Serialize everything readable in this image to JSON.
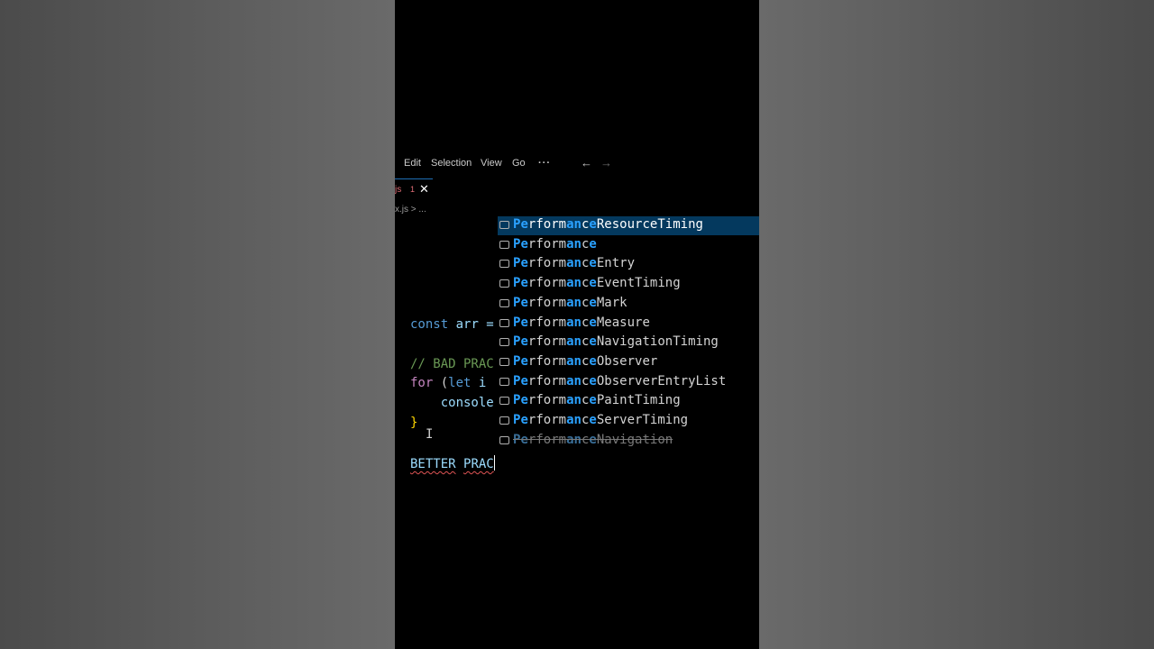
{
  "menubar": {
    "edit": "Edit",
    "selection": "Selection",
    "view": "View",
    "go": "Go",
    "more": "···",
    "back": "←",
    "forward": "→"
  },
  "tab": {
    "name": "js",
    "problems": "1",
    "close": "✕"
  },
  "breadcrumb": "x.js > ...",
  "code": {
    "line1_kw": "const",
    "line1_rest": " arr =",
    "line2_comment": "// BAD PRAC",
    "line3_kw": "for",
    "line3_rest": " (",
    "line3_let": "let",
    "line3_tail": " i",
    "line4": "    console",
    "line5_brace": "}",
    "line6_word1": "BETTER",
    "line6_word2": "PRAC"
  },
  "suggestions": {
    "match_prefix": "Pe",
    "items": [
      {
        "label": "PerformanceResourceTiming",
        "selected": true,
        "deprecated": false
      },
      {
        "label": "Performance",
        "selected": false,
        "deprecated": false
      },
      {
        "label": "PerformanceEntry",
        "selected": false,
        "deprecated": false
      },
      {
        "label": "PerformanceEventTiming",
        "selected": false,
        "deprecated": false
      },
      {
        "label": "PerformanceMark",
        "selected": false,
        "deprecated": false
      },
      {
        "label": "PerformanceMeasure",
        "selected": false,
        "deprecated": false
      },
      {
        "label": "PerformanceNavigationTiming",
        "selected": false,
        "deprecated": false
      },
      {
        "label": "PerformanceObserver",
        "selected": false,
        "deprecated": false
      },
      {
        "label": "PerformanceObserverEntryList",
        "selected": false,
        "deprecated": false
      },
      {
        "label": "PerformancePaintTiming",
        "selected": false,
        "deprecated": false
      },
      {
        "label": "PerformanceServerTiming",
        "selected": false,
        "deprecated": false
      },
      {
        "label": "PerformanceNavigation",
        "selected": false,
        "deprecated": true
      }
    ],
    "icon": "variable-icon",
    "icon_glyph": "[e]"
  },
  "colors": {
    "editor_bg": "#000000",
    "selection_bg": "#04395e",
    "match_highlight": "#2aa1ff",
    "keyword": "#569cd6"
  }
}
